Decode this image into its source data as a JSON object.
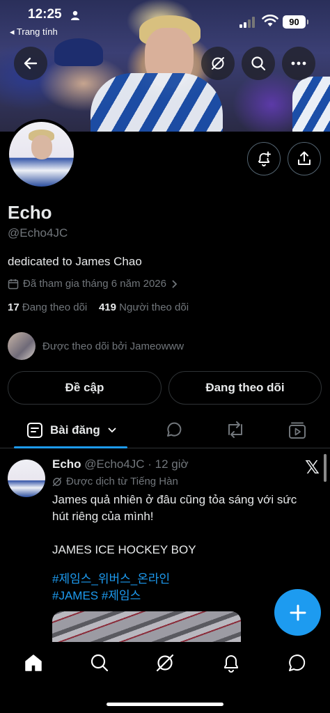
{
  "status_bar": {
    "time": "12:25",
    "back_app": "◂ Trang tính",
    "battery": "90"
  },
  "profile": {
    "name": "Echo",
    "handle": "@Echo4JC",
    "bio": "dedicated to James Chao",
    "joined": "Đã tham gia tháng 6 năm 2026",
    "following_count": "17",
    "following_label": "Đang theo dõi",
    "followers_count": "419",
    "followers_label": "Người theo dõi",
    "followed_by": "Được theo dõi bởi Jameowww"
  },
  "buttons": {
    "mention": "Đề cập",
    "following": "Đang theo dõi"
  },
  "tabs": {
    "posts": "Bài đăng"
  },
  "post": {
    "author": "Echo",
    "meta": "@Echo4JC · 12 giờ",
    "translated": "Được dịch từ Tiếng Hàn",
    "line1": "James quả nhiên ở đâu cũng tỏa sáng với sức",
    "line2": "hút riêng của mình!",
    "line3": "JAMES ICE HOCKEY BOY",
    "hashtag1": "#제임스_위버스_온라인",
    "hashtag2": "#JAMES #제임스"
  },
  "colors": {
    "accent": "#1d9bf0",
    "text": "#e7e9ea",
    "muted": "#71767b",
    "border": "#2f3336"
  }
}
